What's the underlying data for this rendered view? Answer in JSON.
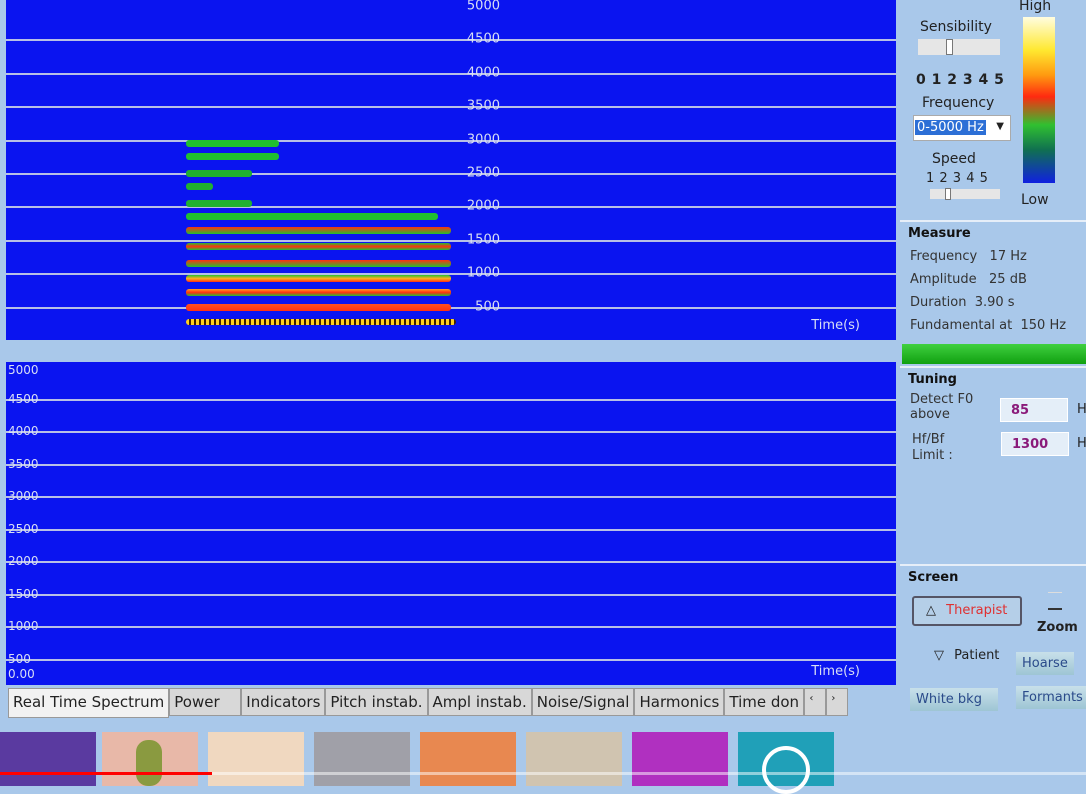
{
  "top_spectrum": {
    "freq_labels": [
      "5000",
      "4500",
      "4000",
      "3500",
      "3000",
      "2500",
      "2000",
      "1500",
      "1000",
      "500"
    ],
    "time_label": "Time(s)"
  },
  "bottom_spectrum": {
    "freq_labels": [
      "5000",
      "4500",
      "4000",
      "3500",
      "3000",
      "2500",
      "2000",
      "1500",
      "1000",
      "500"
    ],
    "origin_label": "0.00",
    "time_label": "Time(s)"
  },
  "settings": {
    "sensibility_label": "Sensibility",
    "sensibility_scale": "0 1 2 3 4 5",
    "sensibility_value": 2,
    "frequency_label": "Frequency",
    "frequency_value": "0-5000 Hz",
    "speed_label": "Speed",
    "speed_scale": "1 2 3 4 5",
    "speed_value": 2,
    "color_high": "High",
    "color_low": "Low"
  },
  "measure": {
    "title": "Measure",
    "rows": [
      "Frequency   17 Hz",
      "Amplitude   25 dB",
      "Duration  3.90 s",
      "Fundamental at  150 Hz"
    ]
  },
  "tuning": {
    "title": "Tuning",
    "detect_label": "Detect F0 above",
    "detect_value": "85",
    "limit_label": "Hf/Bf Limit :",
    "limit_value": "1300",
    "unit": "H"
  },
  "screen": {
    "title": "Screen",
    "therapist": "Therapist",
    "zoom": "Zoom",
    "patient": "Patient",
    "hoarse": "Hoarse",
    "white_bkg": "White bkg",
    "formants": "Formants"
  },
  "tabs": [
    "Real Time Spectrum",
    "Power",
    "Indicators",
    "Pitch instab.",
    "Ampl instab.",
    "Noise/Signal",
    "Harmonics",
    "Time don"
  ],
  "colors": {
    "spectrum_bg": "#0a14f0",
    "panel_bg": "#a9c8ea",
    "therapist": "#e03030"
  }
}
